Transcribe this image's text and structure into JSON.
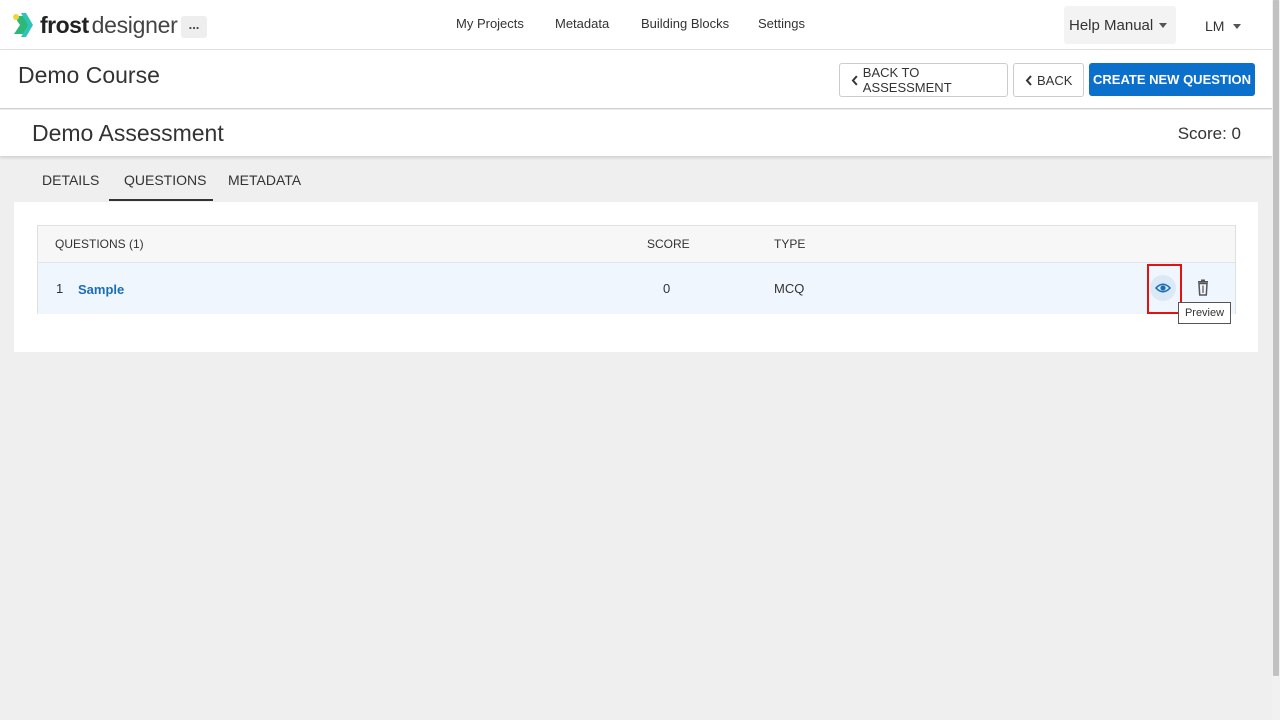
{
  "brand": {
    "name_bold": "frost",
    "name_light": "designer",
    "accent_colors": {
      "arrow_yellow": "#f4d23a",
      "arrow_teal": "#2ec4b6",
      "arrow_green": "#2cb978"
    }
  },
  "topbar": {
    "more_label": "...",
    "nav": [
      "My Projects",
      "Metadata",
      "Building Blocks",
      "Settings"
    ],
    "help_label": "Help Manual",
    "user_initials": "LM"
  },
  "course": {
    "title": "Demo Course",
    "back_to_assessment_label": "BACK TO ASSESSMENT",
    "back_label": "BACK",
    "create_label": "CREATE NEW QUESTION"
  },
  "assessment": {
    "title": "Demo Assessment",
    "score_label": "Score: 0"
  },
  "tabs": {
    "items": [
      "DETAILS",
      "QUESTIONS",
      "METADATA"
    ],
    "active": "QUESTIONS"
  },
  "questions_table": {
    "headers": {
      "questions": "QUESTIONS (1)",
      "score": "SCORE",
      "type": "TYPE"
    },
    "rows": [
      {
        "index": "1",
        "name": "Sample",
        "score": "0",
        "type": "MCQ"
      }
    ],
    "row_actions": [
      "eye-icon",
      "trash-icon"
    ]
  },
  "tooltip": {
    "preview": "Preview"
  },
  "colors": {
    "primary": "#0b6fcc",
    "link": "#1a6eb8",
    "row_highlight": "#f0f6fd",
    "annotation_red": "#e31212"
  }
}
